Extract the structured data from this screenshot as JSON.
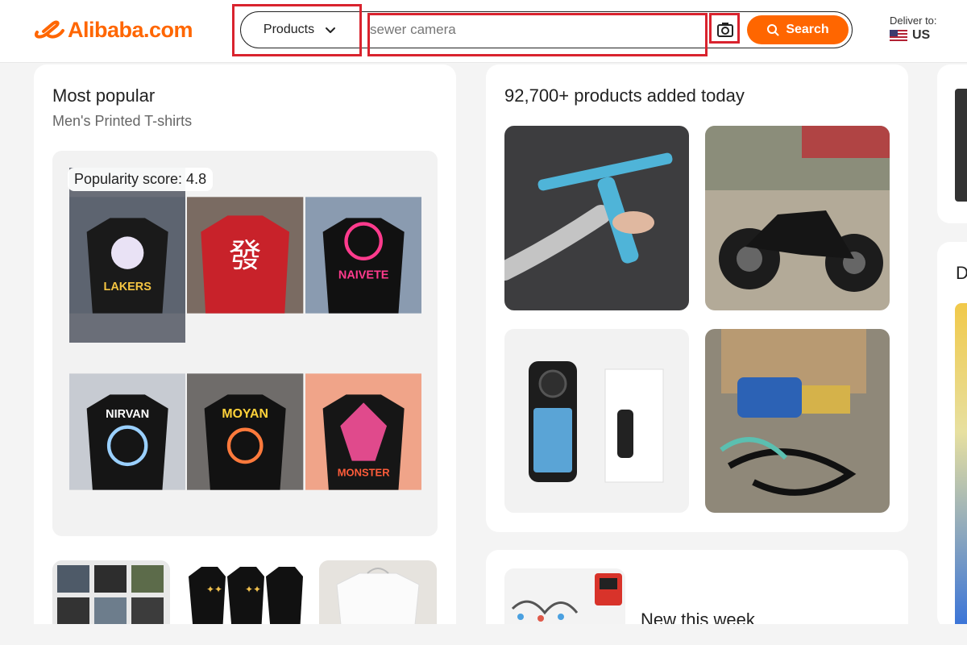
{
  "brand": {
    "logo_text": "Alibaba.com",
    "accent": "#ff6600"
  },
  "search": {
    "category": "Products",
    "placeholder": "sewer camera",
    "camera_icon": "camera-icon",
    "button_label": "Search"
  },
  "deliver": {
    "label": "Deliver to:",
    "country": "US"
  },
  "popular": {
    "title": "Most popular",
    "subtitle": "Men's Printed T-shirts",
    "badge": "Popularity score: 4.8"
  },
  "added": {
    "title": "92,700+ products added today"
  },
  "new_week": {
    "title": "New this week"
  },
  "right_peek": {
    "letter": "D"
  },
  "colors": {
    "highlight": "#d9232e",
    "bg": "#f4f4f4"
  }
}
